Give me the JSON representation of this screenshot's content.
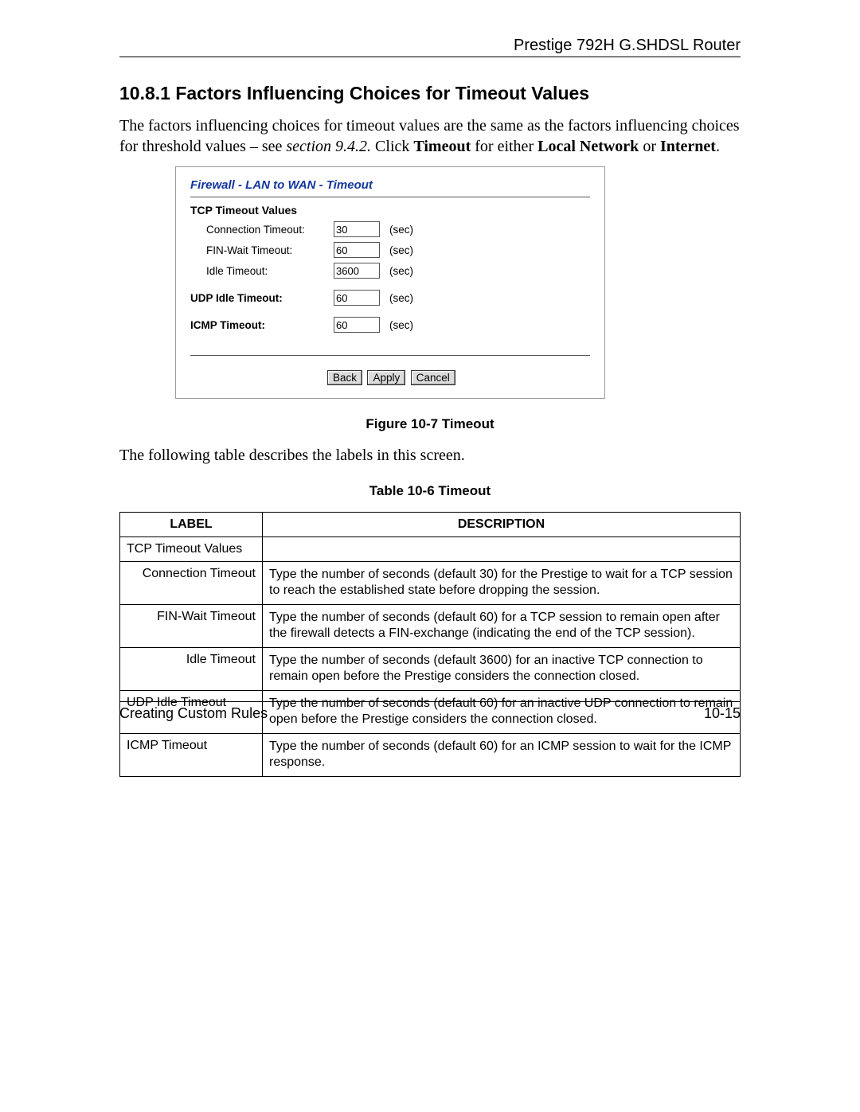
{
  "header": {
    "product": "Prestige 792H G.SHDSL Router"
  },
  "section": {
    "number": "10.8.1",
    "title": "Factors Influencing Choices for Timeout Values",
    "intro_before_ref": "The factors influencing choices for timeout values are the same as the factors influencing choices for threshold values – see ",
    "ref": "section 9.4.2.",
    "intro_after_click": " Click ",
    "timeout_word": "Timeout",
    "intro_for_either": " for either ",
    "local_network": "Local Network",
    "intro_or": " or ",
    "internet": "Internet",
    "period": "."
  },
  "panel": {
    "title": "Firewall - LAN to WAN - Timeout",
    "tcp_heading": "TCP Timeout Values",
    "tcp_fields": {
      "connection": {
        "label": "Connection Timeout:",
        "value": "30",
        "unit": "(sec)"
      },
      "finwait": {
        "label": "FIN-Wait Timeout:",
        "value": "60",
        "unit": "(sec)"
      },
      "idle": {
        "label": "Idle Timeout:",
        "value": "3600",
        "unit": "(sec)"
      }
    },
    "udp": {
      "heading": "UDP Idle Timeout:",
      "value": "60",
      "unit": "(sec)"
    },
    "icmp": {
      "heading": "ICMP Timeout:",
      "value": "60",
      "unit": "(sec)"
    },
    "buttons": {
      "back": "Back",
      "apply": "Apply",
      "cancel": "Cancel"
    }
  },
  "figure_caption": "Figure 10-7 Timeout",
  "following_text": "The following table describes the labels in this screen.",
  "table_caption": "Table 10-6 Timeout",
  "table": {
    "head": {
      "label": "LABEL",
      "desc": "DESCRIPTION"
    },
    "rows": [
      {
        "label": "TCP Timeout Values",
        "left": true,
        "desc": ""
      },
      {
        "label": "Connection Timeout",
        "desc": "Type the number of seconds (default 30) for the Prestige to wait for a TCP session to reach the established state before dropping the session."
      },
      {
        "label": "FIN-Wait Timeout",
        "desc": "Type the number of seconds (default 60) for a TCP session to remain open after the firewall detects a FIN-exchange (indicating the end of the TCP session)."
      },
      {
        "label": "Idle Timeout",
        "desc": "Type the number of seconds (default 3600) for an inactive TCP connection to remain open before the Prestige considers the connection closed."
      },
      {
        "label": "UDP Idle Timeout",
        "left": true,
        "desc": "Type the number of seconds (default 60) for an inactive UDP connection to remain open before the Prestige considers the connection closed."
      },
      {
        "label": "ICMP Timeout",
        "left": true,
        "desc": "Type the number of seconds (default 60) for an ICMP session to wait for the ICMP response."
      }
    ]
  },
  "footer": {
    "left": "Creating Custom Rules",
    "right": "10-15"
  }
}
